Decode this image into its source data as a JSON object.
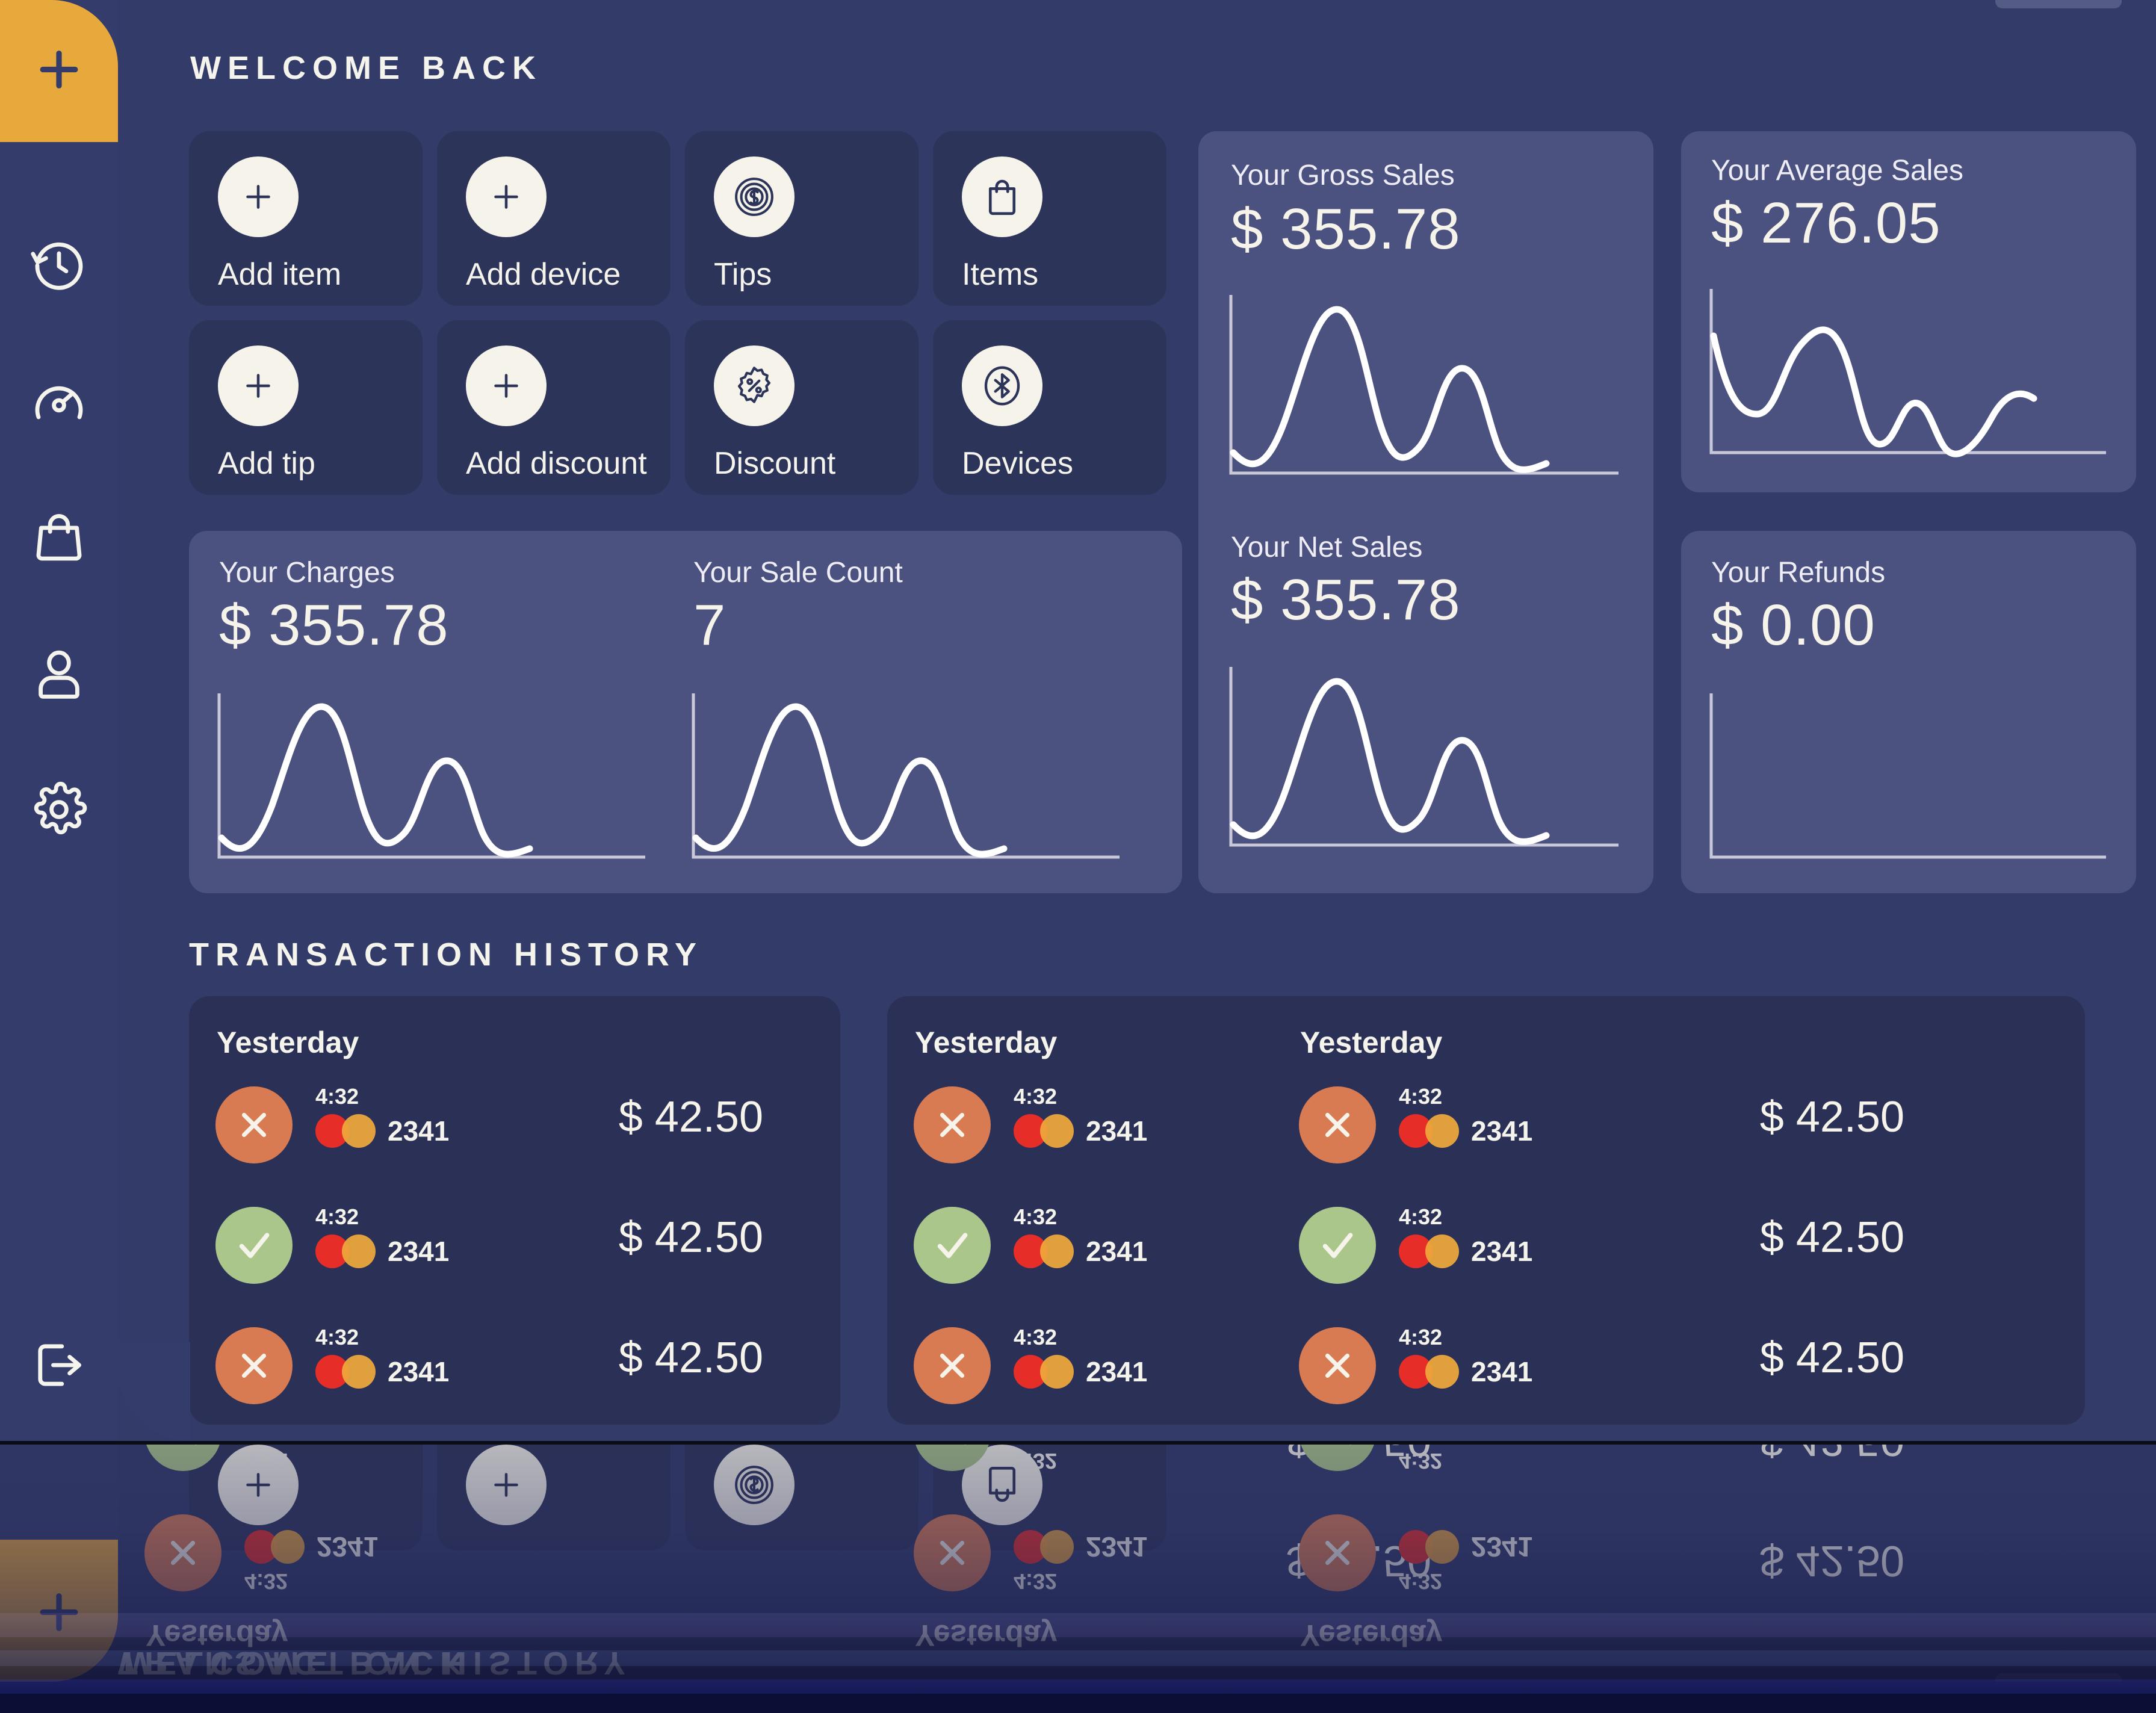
{
  "colors": {
    "page_bg": "#333b69",
    "sidebar_bg": "#343c6b",
    "accent_yellow": "#e8a93c",
    "action_card_bg": "#2d3459",
    "stat_card_bg": "#4c5280",
    "txn_card_bg": "#2b3156",
    "status_declined": "#d97b52",
    "status_approved": "#abc68a",
    "mastercard_red": "#e62d27",
    "mastercard_yellow": "#f0a93b",
    "text_light": "#f4f3ec"
  },
  "sidebar": {
    "add_button": {
      "label": "add",
      "icon": "plus-icon"
    },
    "items": [
      {
        "name": "history",
        "icon": "history-clock-icon"
      },
      {
        "name": "reports",
        "icon": "speedometer-icon"
      },
      {
        "name": "items",
        "icon": "shopping-bag-icon"
      },
      {
        "name": "customers",
        "icon": "user-icon"
      },
      {
        "name": "settings",
        "icon": "gear-icon"
      }
    ],
    "logout": {
      "name": "logout",
      "icon": "logout-icon"
    }
  },
  "header": {
    "title": "WELCOME BACK"
  },
  "actions": [
    {
      "label": "Add item",
      "icon": "plus-icon"
    },
    {
      "label": "Add device",
      "icon": "plus-icon"
    },
    {
      "label": "Tips",
      "icon": "coin-dollar-icon"
    },
    {
      "label": "Items",
      "icon": "shopping-bag-icon"
    },
    {
      "label": "Add tip",
      "icon": "plus-icon"
    },
    {
      "label": "Add discount",
      "icon": "plus-icon"
    },
    {
      "label": "Discount",
      "icon": "discount-badge-icon"
    },
    {
      "label": "Devices",
      "icon": "bluetooth-icon"
    }
  ],
  "stats": [
    {
      "key": "gross",
      "title": "Your Gross Sales",
      "value": "$ 355.78"
    },
    {
      "key": "average",
      "title": "Your Average Sales",
      "value": "$ 276.05"
    },
    {
      "key": "charges",
      "title": "Your Charges",
      "value": "$ 355.78"
    },
    {
      "key": "count",
      "title": "Your Sale Count",
      "value": "7"
    },
    {
      "key": "net",
      "title": "Your Net Sales",
      "value": "$ 355.78"
    },
    {
      "key": "refunds",
      "title": "Your Refunds",
      "value": "$ 0.00"
    }
  ],
  "history": {
    "title": "TRANSACTION HISTORY",
    "columns": [
      {
        "day": "Yesterday",
        "rows": [
          {
            "status": "declined",
            "status_icon": "x-icon",
            "time": "4:32",
            "brand": "mastercard-logo",
            "digits": "2341",
            "amount": "$ 42.50"
          },
          {
            "status": "approved",
            "status_icon": "check-icon",
            "time": "4:32",
            "brand": "mastercard-logo",
            "digits": "2341",
            "amount": "$ 42.50"
          },
          {
            "status": "declined",
            "status_icon": "x-icon",
            "time": "4:32",
            "brand": "mastercard-logo",
            "digits": "2341",
            "amount": "$ 42.50"
          }
        ]
      },
      {
        "day": "Yesterday",
        "rows": [
          {
            "status": "declined",
            "status_icon": "x-icon",
            "time": "4:32",
            "brand": "mastercard-logo",
            "digits": "2341",
            "amount": "$ 42.50"
          },
          {
            "status": "approved",
            "status_icon": "check-icon",
            "time": "4:32",
            "brand": "mastercard-logo",
            "digits": "2341",
            "amount": "$ 42.50"
          },
          {
            "status": "declined",
            "status_icon": "x-icon",
            "time": "4:32",
            "brand": "mastercard-logo",
            "digits": "2341",
            "amount": "$ 42.50"
          }
        ]
      },
      {
        "day": "Yesterday",
        "rows": [
          {
            "status": "declined",
            "status_icon": "x-icon",
            "time": "4:32",
            "brand": "mastercard-logo",
            "digits": "2341",
            "amount": "$ 42.50"
          },
          {
            "status": "approved",
            "status_icon": "check-icon",
            "time": "4:32",
            "brand": "mastercard-logo",
            "digits": "2341",
            "amount": "$ 42.50"
          },
          {
            "status": "declined",
            "status_icon": "x-icon",
            "time": "4:32",
            "brand": "mastercard-logo",
            "digits": "2341",
            "amount": "$ 42.50"
          }
        ]
      }
    ]
  },
  "chart_data": [
    {
      "type": "line",
      "key": "gross",
      "title": "Your Gross Sales",
      "x": [
        0,
        1,
        2,
        3,
        4,
        5,
        6,
        7,
        8,
        9,
        10
      ],
      "values": [
        18,
        12,
        70,
        88,
        40,
        16,
        46,
        60,
        34,
        8,
        12
      ],
      "ylim": [
        0,
        100
      ],
      "grid": false,
      "axes": [
        "left",
        "bottom"
      ]
    },
    {
      "type": "line",
      "key": "average",
      "title": "Your Average Sales",
      "x": [
        0,
        1,
        2,
        3,
        4,
        5,
        6,
        7,
        8,
        9,
        10
      ],
      "values": [
        62,
        34,
        28,
        52,
        72,
        44,
        10,
        20,
        44,
        6,
        14,
        40
      ],
      "ylim": [
        0,
        100
      ],
      "grid": false,
      "axes": [
        "left",
        "bottom"
      ]
    },
    {
      "type": "line",
      "key": "charges",
      "title": "Your Charges",
      "x": [
        0,
        1,
        2,
        3,
        4,
        5,
        6,
        7,
        8,
        9,
        10
      ],
      "values": [
        18,
        12,
        70,
        88,
        40,
        16,
        46,
        60,
        34,
        8,
        12
      ],
      "ylim": [
        0,
        100
      ],
      "grid": false,
      "axes": [
        "left",
        "bottom"
      ]
    },
    {
      "type": "line",
      "key": "count",
      "title": "Your Sale Count",
      "x": [
        0,
        1,
        2,
        3,
        4,
        5,
        6,
        7,
        8,
        9,
        10
      ],
      "values": [
        18,
        12,
        70,
        88,
        40,
        16,
        46,
        60,
        34,
        8,
        12
      ],
      "ylim": [
        0,
        100
      ],
      "grid": false,
      "axes": [
        "left",
        "bottom"
      ]
    },
    {
      "type": "line",
      "key": "net",
      "title": "Your Net Sales",
      "x": [
        0,
        1,
        2,
        3,
        4,
        5,
        6,
        7,
        8,
        9,
        10
      ],
      "values": [
        18,
        12,
        70,
        88,
        40,
        16,
        46,
        60,
        34,
        8,
        12
      ],
      "ylim": [
        0,
        100
      ],
      "grid": false,
      "axes": [
        "left",
        "bottom"
      ]
    },
    {
      "type": "line",
      "key": "refunds",
      "title": "Your Refunds",
      "x": [],
      "values": [],
      "ylim": [
        0,
        100
      ],
      "grid": false,
      "axes": [
        "left",
        "bottom"
      ]
    }
  ]
}
